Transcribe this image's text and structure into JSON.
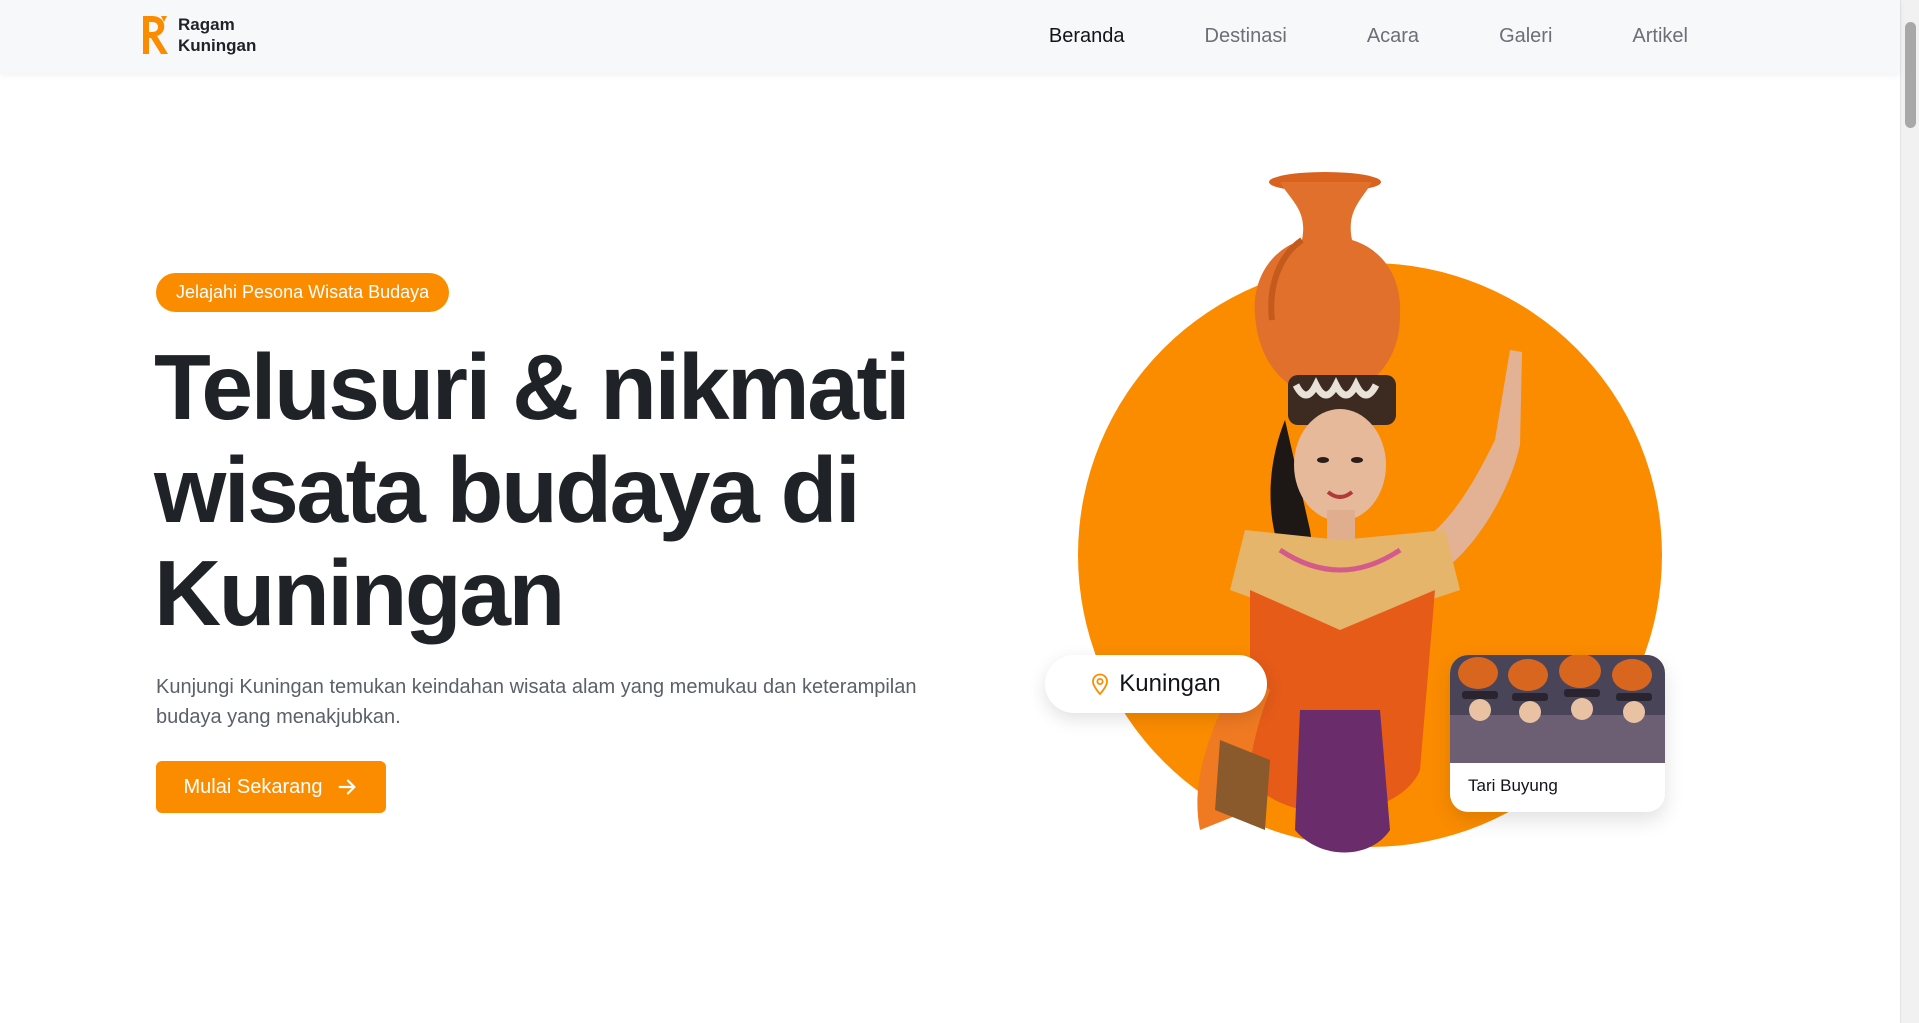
{
  "brand": {
    "line1": "Ragam",
    "line2": "Kuningan",
    "accent": "#fb8c00"
  },
  "nav": {
    "items": [
      {
        "label": "Beranda",
        "active": true
      },
      {
        "label": "Destinasi",
        "active": false
      },
      {
        "label": "Acara",
        "active": false
      },
      {
        "label": "Galeri",
        "active": false
      },
      {
        "label": "Artikel",
        "active": false
      }
    ]
  },
  "hero": {
    "badge": "Jelajahi Pesona Wisata Budaya",
    "title_lines": [
      "Telusuri & nikmati",
      "wisata budaya di",
      "Kuningan"
    ],
    "description": "Kunjungi Kuningan temukan keindahan wisata alam yang memukau dan keterampilan budaya yang menakjubkan.",
    "cta_label": "Mulai Sekarang",
    "cta_icon": "arrow-right-icon"
  },
  "location_pill": {
    "label": "Kuningan",
    "icon": "map-pin-icon"
  },
  "featured_card": {
    "caption": "Tari Buyung"
  },
  "colors": {
    "orange": "#fb8c00",
    "text_dark": "#1f2328",
    "text_muted": "#5b6069",
    "header_bg": "#f7f8fa"
  }
}
